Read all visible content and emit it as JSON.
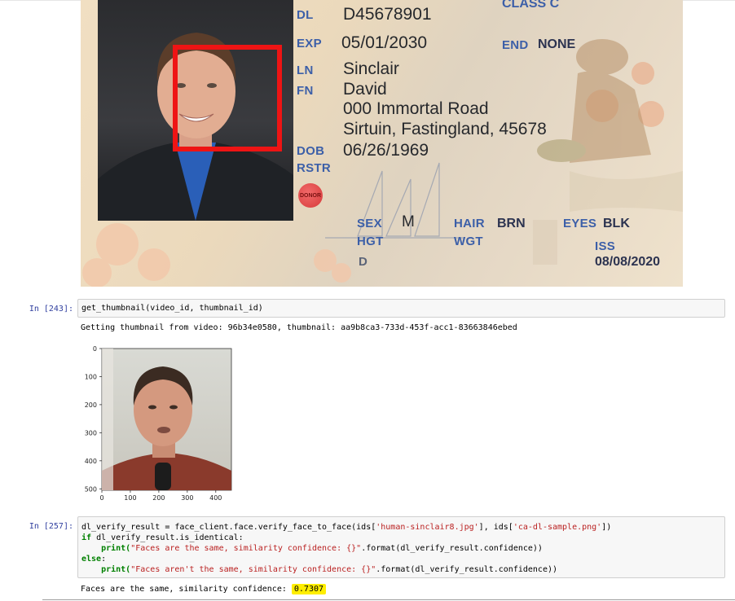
{
  "license": {
    "class_label": "CLASS C",
    "dl_label": "DL",
    "dl_value": "D45678901",
    "exp_label": "EXP",
    "exp_value": "05/01/2030",
    "end_label": "END",
    "end_value": "NONE",
    "ln_label": "LN",
    "ln_value": "Sinclair",
    "fn_label": "FN",
    "fn_value": "David",
    "address_line1": "000 Immortal Road",
    "address_line2": "Sirtuin, Fastingland, 45678",
    "dob_label": "DOB",
    "dob_value": "06/26/1969",
    "rstr_label": "RSTR",
    "donor_label": "DONOR",
    "sex_label": "SEX",
    "sex_value": "M",
    "hair_label": "HAIR",
    "hair_value": "BRN",
    "eyes_label": "EYES",
    "eyes_value": "BLK",
    "hgt_label": "HGT",
    "wgt_label": "WGT",
    "iss_label": "ISS",
    "iss_value": "08/08/2020",
    "d_label": "D",
    "face_box_color": "#ee1414"
  },
  "cells": [
    {
      "prompt": "In [243]:",
      "code": [
        "get_thumbnail(video_id, thumbnail_id)"
      ],
      "output": "Getting thumbnail from video: 96b34e0580, thumbnail: aa9b8ca3-733d-453f-acc1-83663846ebed"
    },
    {
      "prompt": "In [257]:",
      "code_parts": {
        "l1_a": "dl_verify_result = face_client.face.verify_face_to_face(ids[",
        "l1_s1": "'human-sinclair8.jpg'",
        "l1_b": "], ids[",
        "l1_s2": "'ca-dl-sample.png'",
        "l1_c": "])",
        "l2_kw": "if",
        "l2_rest": " dl_verify_result.is_identical:",
        "l3_fn": "    print(",
        "l3_str": "\"Faces are the same, similarity confidence: {}\"",
        "l3_rest": ".format(dl_verify_result.confidence))",
        "l4_kw": "else",
        "l4_rest": ":",
        "l5_fn": "    print(",
        "l5_str": "\"Faces aren't the same, similarity confidence: {}\"",
        "l5_rest": ".format(dl_verify_result.confidence))"
      },
      "output_prefix": "Faces are the same, similarity confidence: ",
      "output_value": "0.7307"
    }
  ],
  "thumbnail_plot": {
    "y_ticks": [
      "0",
      "100",
      "200",
      "300",
      "400",
      "500"
    ],
    "x_ticks": [
      "0",
      "100",
      "200",
      "300",
      "400"
    ]
  },
  "colors": {
    "prompt": "#303f9f",
    "keyword": "#008000",
    "string": "#ba2121",
    "highlight": "#ffee00"
  }
}
